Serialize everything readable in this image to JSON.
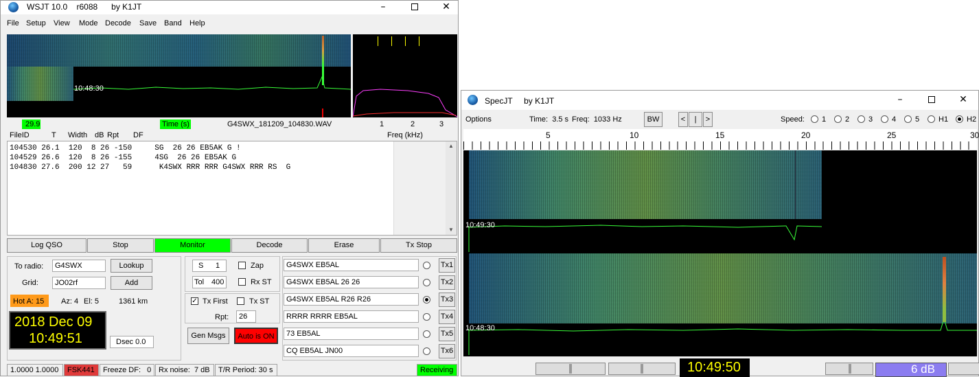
{
  "wsjt": {
    "title": "WSJT 10.0    r6088      by K1JT",
    "menu": [
      "File",
      "Setup",
      "View",
      "Mode",
      "Decode",
      "Save",
      "Band",
      "Help"
    ],
    "waterfall_time": "10:48:30",
    "db_value": "29.9",
    "time_label": "Time (s)",
    "filename": "G4SWX_181209_104830.WAV",
    "freq_ticks": [
      "1",
      "2",
      "3"
    ],
    "freq_label": "Freq (kHz)",
    "headers": [
      "FileID",
      "T",
      "Width",
      "dB",
      "Rpt",
      "DF"
    ],
    "decodes": [
      "104530 26.1  120  8 26 -150     SG  26 26 EB5AK G !",
      "104529 26.6  120  8 26 -155     4SG  26 26 EB5AK G",
      "104830 27.6  200 12 27   59      K4SWX RRR RRR G4SWX RRR RS  G"
    ],
    "buttons": [
      "Log QSO",
      "Stop",
      "Monitor",
      "Decode",
      "Erase",
      "Tx Stop"
    ],
    "to_radio_label": "To radio:",
    "to_radio": "G4SWX",
    "grid_label": "Grid:",
    "grid": "JO02rf",
    "lookup": "Lookup",
    "add": "Add",
    "hot_a": "Hot A: 15",
    "az": "Az: 4",
    "el": "El: 5",
    "distance": "1361 km",
    "date": "2018 Dec 09",
    "clock": "10:49:51",
    "dsec": "Dsec  0.0",
    "s_label": "S",
    "s_value": "1",
    "tol_label": "Tol",
    "tol_value": "400",
    "zap": "Zap",
    "rx_st": "Rx ST",
    "tx_first": "Tx First",
    "tx_st": "Tx ST",
    "rpt_label": "Rpt:",
    "rpt_value": "26",
    "gen_msgs": "Gen Msgs",
    "auto_is_on": "Auto is  ON",
    "messages": [
      "G4SWX EB5AL",
      "G4SWX EB5AL 26 26",
      "G4SWX EB5AL R26 R26",
      "RRRR RRRR EB5AL",
      "73 EB5AL",
      "CQ EB5AL JN00"
    ],
    "tx_labels": [
      "Tx1",
      "Tx2",
      "Tx3",
      "Tx4",
      "Tx5",
      "Tx6"
    ],
    "tx_selected": 3,
    "status": {
      "levels": "1.0000 1.0000",
      "mode": "FSK441",
      "freeze": "Freeze DF:   0",
      "rxnoise": "Rx noise:  7 dB",
      "tr": "T/R Period: 30 s",
      "state": "Receiving"
    }
  },
  "specjt": {
    "title": "SpecJT     by K1JT",
    "options": "Options",
    "time": "Time:  3.5 s",
    "freq": "Freq:  1033 Hz",
    "bw": "BW",
    "nav": [
      "<",
      "|",
      ">"
    ],
    "speed_label": "Speed:",
    "speeds": [
      "1",
      "2",
      "3",
      "4",
      "5",
      "H1",
      "H2"
    ],
    "speed_selected": "H2",
    "scale": [
      "5",
      "10",
      "15",
      "20",
      "25",
      "30"
    ],
    "wf_time_top": "10:49:30",
    "wf_time_bottom": "10:48:30",
    "clock": "10:49:50",
    "db": "6 dB"
  },
  "colors": {
    "green": "#00ff00",
    "red": "#ff0000",
    "orange": "#ff9a1a",
    "clock_yellow": "#ffff00",
    "db_purple": "#8b7cf0"
  }
}
